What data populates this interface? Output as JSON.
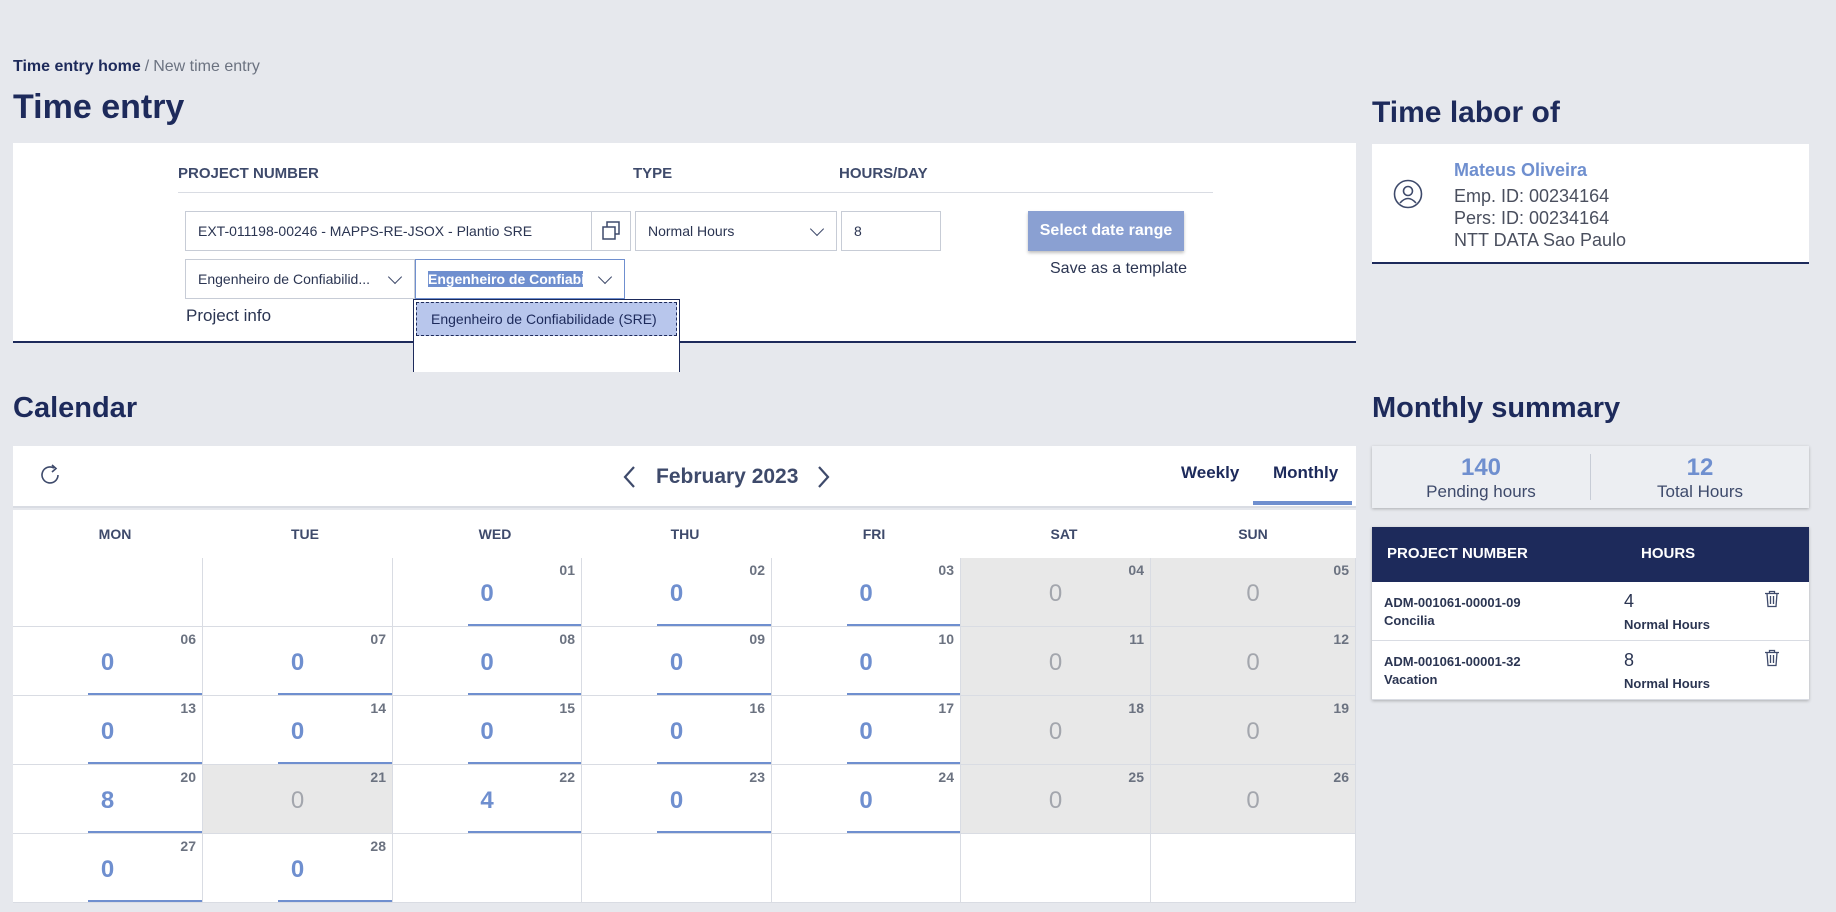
{
  "breadcrumb": {
    "home": "Time entry home",
    "separator": "/",
    "current": "New time entry"
  },
  "time_entry": {
    "title": "Time entry",
    "headers": {
      "project_number": "PROJECT NUMBER",
      "type": "TYPE",
      "hours_day": "HOURS/DAY"
    },
    "project_value": "EXT-011198-00246 - MAPPS-RE-JSOX - Plantio SRE",
    "type_value": "Normal Hours",
    "hours_value": "8",
    "role_value": "Engenheiro de Confiabilid...",
    "role_search_value": "Engenheiro de Confiabili",
    "dropdown_options": [
      "Engenheiro de Confiabilidade (SRE)"
    ],
    "select_date_range": "Select date range",
    "save_template": "Save as a template",
    "project_info": "Project info"
  },
  "labor": {
    "title": "Time labor of",
    "name": "Mateus Oliveira",
    "emp_id": "Emp. ID: 00234164",
    "pers_id": "Pers: ID: 00234164",
    "office": "NTT DATA Sao Paulo"
  },
  "calendar": {
    "title": "Calendar",
    "month": "February 2023",
    "views": {
      "weekly": "Weekly",
      "monthly": "Monthly",
      "active": "Monthly"
    },
    "weekdays": [
      "MON",
      "TUE",
      "WED",
      "THU",
      "FRI",
      "SAT",
      "SUN"
    ],
    "weeks": [
      [
        null,
        null,
        {
          "day": "01",
          "hours": "0"
        },
        {
          "day": "02",
          "hours": "0"
        },
        {
          "day": "03",
          "hours": "0"
        },
        {
          "day": "04",
          "hours": "0",
          "off": true
        },
        {
          "day": "05",
          "hours": "0",
          "off": true
        }
      ],
      [
        {
          "day": "06",
          "hours": "0"
        },
        {
          "day": "07",
          "hours": "0"
        },
        {
          "day": "08",
          "hours": "0"
        },
        {
          "day": "09",
          "hours": "0"
        },
        {
          "day": "10",
          "hours": "0"
        },
        {
          "day": "11",
          "hours": "0",
          "off": true
        },
        {
          "day": "12",
          "hours": "0",
          "off": true
        }
      ],
      [
        {
          "day": "13",
          "hours": "0"
        },
        {
          "day": "14",
          "hours": "0"
        },
        {
          "day": "15",
          "hours": "0"
        },
        {
          "day": "16",
          "hours": "0"
        },
        {
          "day": "17",
          "hours": "0"
        },
        {
          "day": "18",
          "hours": "0",
          "off": true
        },
        {
          "day": "19",
          "hours": "0",
          "off": true
        }
      ],
      [
        {
          "day": "20",
          "hours": "8"
        },
        {
          "day": "21",
          "hours": "0",
          "off": true
        },
        {
          "day": "22",
          "hours": "4"
        },
        {
          "day": "23",
          "hours": "0"
        },
        {
          "day": "24",
          "hours": "0"
        },
        {
          "day": "25",
          "hours": "0",
          "off": true
        },
        {
          "day": "26",
          "hours": "0",
          "off": true
        }
      ],
      [
        {
          "day": "27",
          "hours": "0"
        },
        {
          "day": "28",
          "hours": "0"
        },
        null,
        null,
        null,
        null,
        null
      ]
    ]
  },
  "summary": {
    "title": "Monthly summary",
    "pending_hours": "140",
    "pending_label": "Pending hours",
    "total_hours": "12",
    "total_label": "Total Hours",
    "headers": {
      "project_number": "PROJECT NUMBER",
      "hours": "HOURS"
    },
    "rows": [
      {
        "project": "ADM-001061-00001-09",
        "name": "Concilia",
        "hours": "4",
        "type": "Normal Hours"
      },
      {
        "project": "ADM-001061-00001-32",
        "name": "Vacation",
        "hours": "8",
        "type": "Normal Hours"
      }
    ]
  },
  "colors": {
    "navy": "#1d2a5b",
    "accent": "#6f8fcf",
    "button": "#8aa0d2",
    "weekend": "#e8e8e8"
  }
}
